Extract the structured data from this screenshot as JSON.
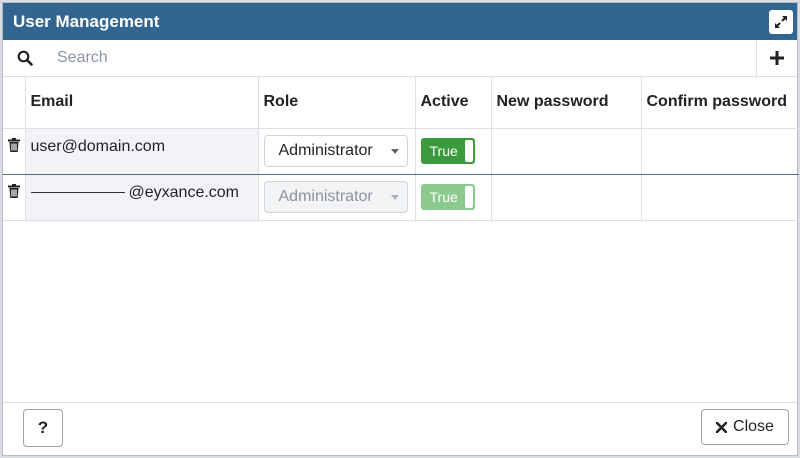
{
  "dialog": {
    "title": "User Management",
    "icons": {
      "expand": "expand-icon",
      "search": "search-icon",
      "add": "plus-icon",
      "delete": "trash-icon",
      "close": "x-icon"
    }
  },
  "search": {
    "placeholder": "Search"
  },
  "table": {
    "columns": [
      "Email",
      "Role",
      "Active",
      "New password",
      "Confirm password"
    ],
    "rows": [
      {
        "email": "user@domain.com",
        "role": "Administrator",
        "active": "True",
        "editable": true
      },
      {
        "email": "@eyxance.com",
        "role": "Administrator",
        "active": "True",
        "editable": false
      }
    ]
  },
  "footer": {
    "help_label": "?",
    "close_label": "Close"
  },
  "colors": {
    "titlebar": "#326690",
    "toggle_on": "#3b9a3e"
  }
}
